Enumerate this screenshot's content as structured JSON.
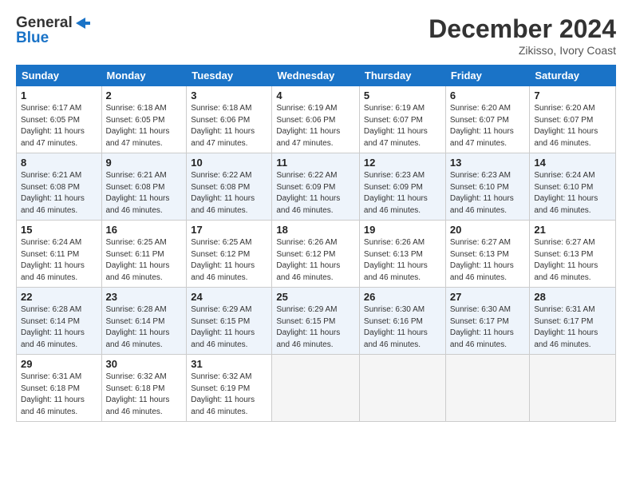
{
  "header": {
    "logo_line1": "General",
    "logo_line2": "Blue",
    "month": "December 2024",
    "location": "Zikisso, Ivory Coast"
  },
  "weekdays": [
    "Sunday",
    "Monday",
    "Tuesday",
    "Wednesday",
    "Thursday",
    "Friday",
    "Saturday"
  ],
  "weeks": [
    [
      {
        "num": "1",
        "rise": "6:17 AM",
        "set": "6:05 PM",
        "hours": "11 hours",
        "mins": "47 minutes"
      },
      {
        "num": "2",
        "rise": "6:18 AM",
        "set": "6:05 PM",
        "hours": "11 hours",
        "mins": "47 minutes"
      },
      {
        "num": "3",
        "rise": "6:18 AM",
        "set": "6:06 PM",
        "hours": "11 hours",
        "mins": "47 minutes"
      },
      {
        "num": "4",
        "rise": "6:19 AM",
        "set": "6:06 PM",
        "hours": "11 hours",
        "mins": "47 minutes"
      },
      {
        "num": "5",
        "rise": "6:19 AM",
        "set": "6:07 PM",
        "hours": "11 hours",
        "mins": "47 minutes"
      },
      {
        "num": "6",
        "rise": "6:20 AM",
        "set": "6:07 PM",
        "hours": "11 hours",
        "mins": "47 minutes"
      },
      {
        "num": "7",
        "rise": "6:20 AM",
        "set": "6:07 PM",
        "hours": "11 hours",
        "mins": "46 minutes"
      }
    ],
    [
      {
        "num": "8",
        "rise": "6:21 AM",
        "set": "6:08 PM",
        "hours": "11 hours",
        "mins": "46 minutes"
      },
      {
        "num": "9",
        "rise": "6:21 AM",
        "set": "6:08 PM",
        "hours": "11 hours",
        "mins": "46 minutes"
      },
      {
        "num": "10",
        "rise": "6:22 AM",
        "set": "6:08 PM",
        "hours": "11 hours",
        "mins": "46 minutes"
      },
      {
        "num": "11",
        "rise": "6:22 AM",
        "set": "6:09 PM",
        "hours": "11 hours",
        "mins": "46 minutes"
      },
      {
        "num": "12",
        "rise": "6:23 AM",
        "set": "6:09 PM",
        "hours": "11 hours",
        "mins": "46 minutes"
      },
      {
        "num": "13",
        "rise": "6:23 AM",
        "set": "6:10 PM",
        "hours": "11 hours",
        "mins": "46 minutes"
      },
      {
        "num": "14",
        "rise": "6:24 AM",
        "set": "6:10 PM",
        "hours": "11 hours",
        "mins": "46 minutes"
      }
    ],
    [
      {
        "num": "15",
        "rise": "6:24 AM",
        "set": "6:11 PM",
        "hours": "11 hours",
        "mins": "46 minutes"
      },
      {
        "num": "16",
        "rise": "6:25 AM",
        "set": "6:11 PM",
        "hours": "11 hours",
        "mins": "46 minutes"
      },
      {
        "num": "17",
        "rise": "6:25 AM",
        "set": "6:12 PM",
        "hours": "11 hours",
        "mins": "46 minutes"
      },
      {
        "num": "18",
        "rise": "6:26 AM",
        "set": "6:12 PM",
        "hours": "11 hours",
        "mins": "46 minutes"
      },
      {
        "num": "19",
        "rise": "6:26 AM",
        "set": "6:13 PM",
        "hours": "11 hours",
        "mins": "46 minutes"
      },
      {
        "num": "20",
        "rise": "6:27 AM",
        "set": "6:13 PM",
        "hours": "11 hours",
        "mins": "46 minutes"
      },
      {
        "num": "21",
        "rise": "6:27 AM",
        "set": "6:13 PM",
        "hours": "11 hours",
        "mins": "46 minutes"
      }
    ],
    [
      {
        "num": "22",
        "rise": "6:28 AM",
        "set": "6:14 PM",
        "hours": "11 hours",
        "mins": "46 minutes"
      },
      {
        "num": "23",
        "rise": "6:28 AM",
        "set": "6:14 PM",
        "hours": "11 hours",
        "mins": "46 minutes"
      },
      {
        "num": "24",
        "rise": "6:29 AM",
        "set": "6:15 PM",
        "hours": "11 hours",
        "mins": "46 minutes"
      },
      {
        "num": "25",
        "rise": "6:29 AM",
        "set": "6:15 PM",
        "hours": "11 hours",
        "mins": "46 minutes"
      },
      {
        "num": "26",
        "rise": "6:30 AM",
        "set": "6:16 PM",
        "hours": "11 hours",
        "mins": "46 minutes"
      },
      {
        "num": "27",
        "rise": "6:30 AM",
        "set": "6:17 PM",
        "hours": "11 hours",
        "mins": "46 minutes"
      },
      {
        "num": "28",
        "rise": "6:31 AM",
        "set": "6:17 PM",
        "hours": "11 hours",
        "mins": "46 minutes"
      }
    ],
    [
      {
        "num": "29",
        "rise": "6:31 AM",
        "set": "6:18 PM",
        "hours": "11 hours",
        "mins": "46 minutes"
      },
      {
        "num": "30",
        "rise": "6:32 AM",
        "set": "6:18 PM",
        "hours": "11 hours",
        "mins": "46 minutes"
      },
      {
        "num": "31",
        "rise": "6:32 AM",
        "set": "6:19 PM",
        "hours": "11 hours",
        "mins": "46 minutes"
      },
      null,
      null,
      null,
      null
    ]
  ]
}
